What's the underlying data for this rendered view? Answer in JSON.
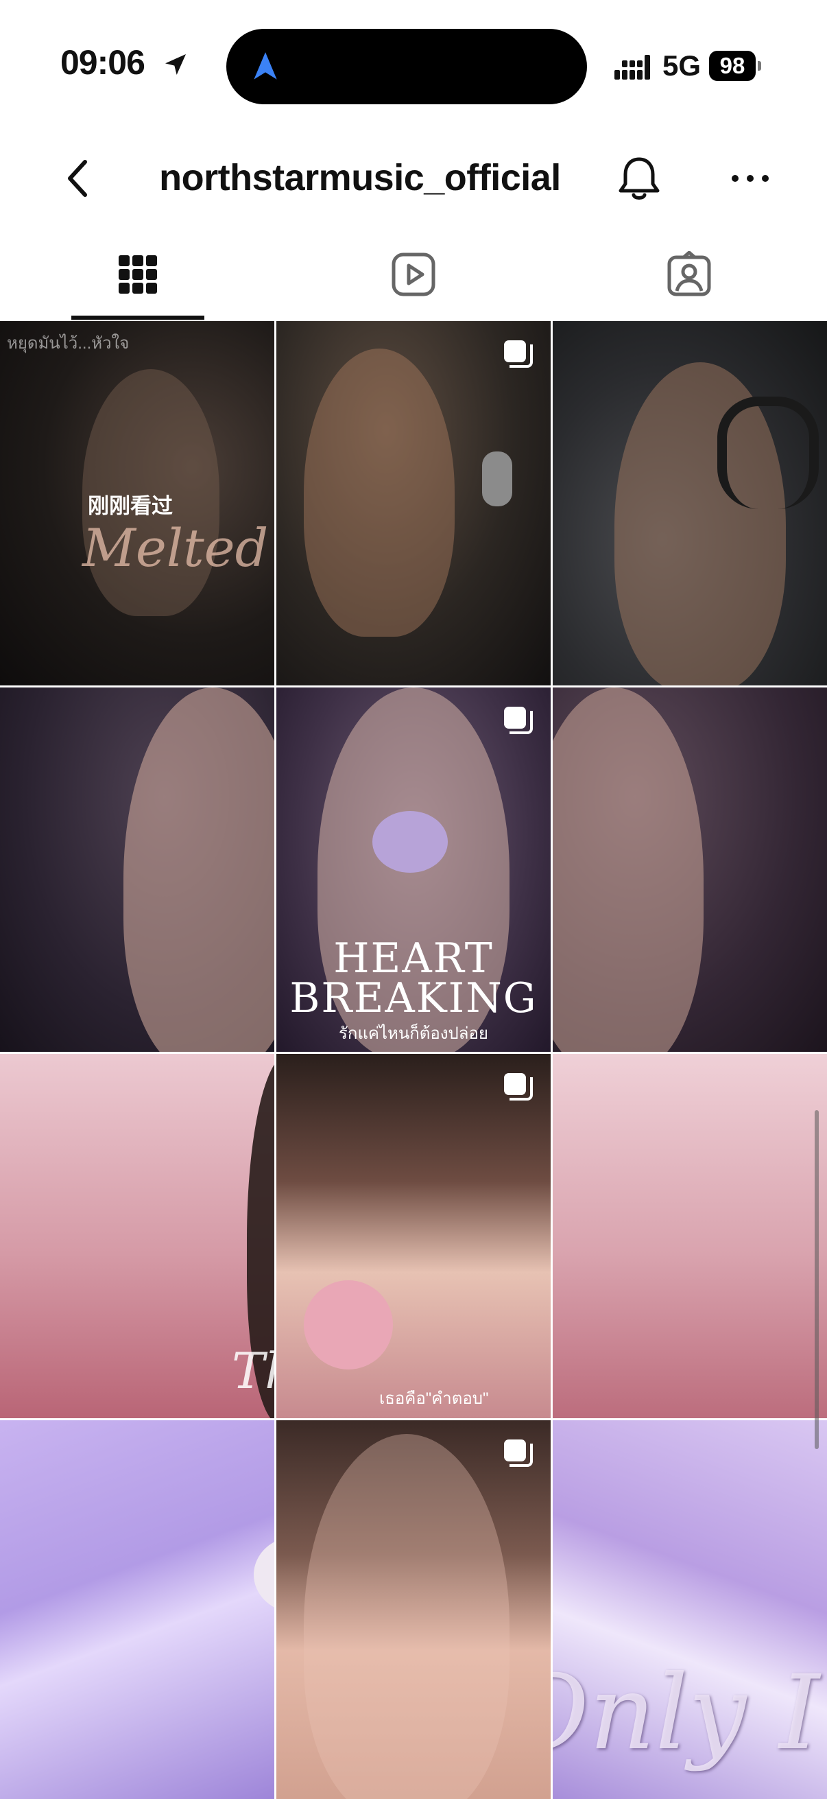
{
  "status_bar": {
    "time": "09:06",
    "network": "5G",
    "battery": "98"
  },
  "header": {
    "username": "northstarmusic_official"
  },
  "tabs": [
    {
      "name": "posts-grid",
      "icon": "grid-icon",
      "active": true
    },
    {
      "name": "reels",
      "icon": "reels-icon",
      "active": false
    },
    {
      "name": "tagged",
      "icon": "tagged-icon",
      "active": false
    }
  ],
  "grid": {
    "recently_viewed": "刚刚看过",
    "post1": {
      "thai_caption": "หยุดมันไว้...หัวใจ",
      "title": "Melted Heart"
    },
    "post2": {
      "title_line1": "HEART",
      "title_line2": "BREAKING",
      "thai_subtitle": "รักแค่ไหนก็ต้องปล่อย"
    },
    "post3": {
      "title": "The World of Us.",
      "thai_subtitle": "เธอคือ\"คำตอบ\""
    },
    "post4": {
      "title": "Only I"
    }
  },
  "colors": {
    "accent_status": "#3b82f6",
    "text": "#111111"
  }
}
